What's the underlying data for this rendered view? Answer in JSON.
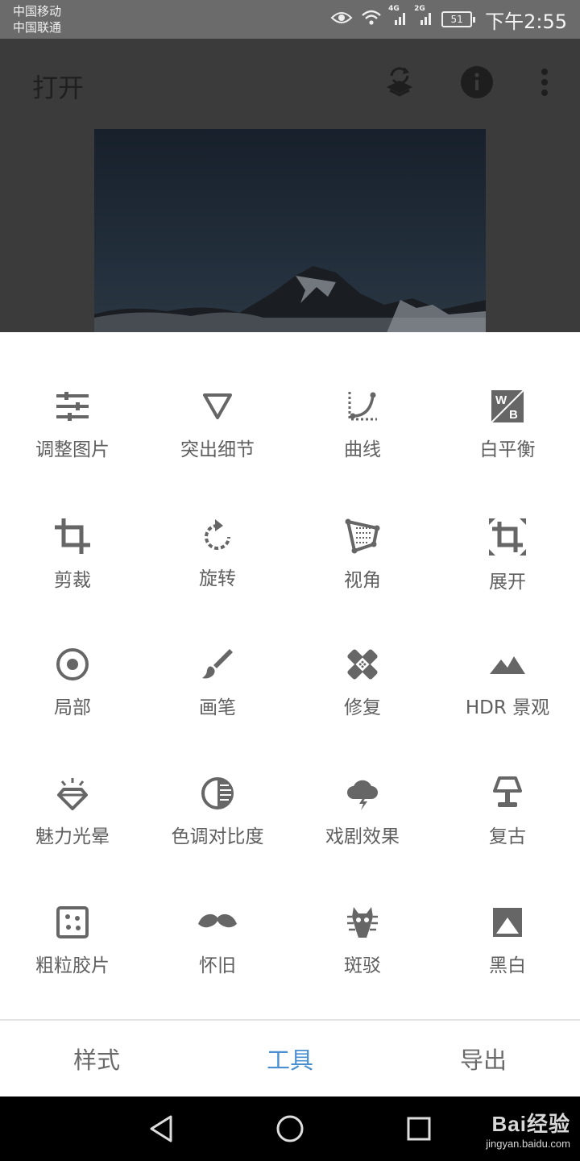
{
  "status_bar": {
    "carrier_1": "中国移动",
    "carrier_2": "中国联通",
    "net_1": "4G",
    "net_2": "2G",
    "battery": "51",
    "time": "下午2:55"
  },
  "app_bar": {
    "title": "打开",
    "icons": [
      "layers-swap-icon",
      "info-icon",
      "more-vert-icon"
    ]
  },
  "tools": [
    {
      "label": "调整图片",
      "icon": "tune-sliders-icon"
    },
    {
      "label": "突出细节",
      "icon": "details-triangle-icon"
    },
    {
      "label": "曲线",
      "icon": "curves-icon"
    },
    {
      "label": "白平衡",
      "icon": "white-balance-icon"
    },
    {
      "label": "剪裁",
      "icon": "crop-icon"
    },
    {
      "label": "旋转",
      "icon": "rotate-icon"
    },
    {
      "label": "视角",
      "icon": "perspective-icon"
    },
    {
      "label": "展开",
      "icon": "expand-icon"
    },
    {
      "label": "局部",
      "icon": "selective-icon"
    },
    {
      "label": "画笔",
      "icon": "brush-icon"
    },
    {
      "label": "修复",
      "icon": "healing-icon"
    },
    {
      "label": "HDR 景观",
      "icon": "hdr-mountain-icon"
    },
    {
      "label": "魅力光晕",
      "icon": "glamour-glow-icon"
    },
    {
      "label": "色调对比度",
      "icon": "tonal-contrast-icon"
    },
    {
      "label": "戏剧效果",
      "icon": "drama-cloud-icon"
    },
    {
      "label": "复古",
      "icon": "vintage-lamp-icon"
    },
    {
      "label": "粗粒胶片",
      "icon": "grainy-film-icon"
    },
    {
      "label": "怀旧",
      "icon": "retrolux-mustache-icon"
    },
    {
      "label": "斑驳",
      "icon": "grunge-icon"
    },
    {
      "label": "黑白",
      "icon": "black-white-icon"
    }
  ],
  "tabs": [
    {
      "label": "样式",
      "active": false
    },
    {
      "label": "工具",
      "active": true
    },
    {
      "label": "导出",
      "active": false
    }
  ],
  "watermark": {
    "main": "Bai经验",
    "sub": "jingyan.baidu.com"
  },
  "colors": {
    "accent": "#4a90d0",
    "icon": "#666666",
    "label": "#5f5f5f"
  }
}
